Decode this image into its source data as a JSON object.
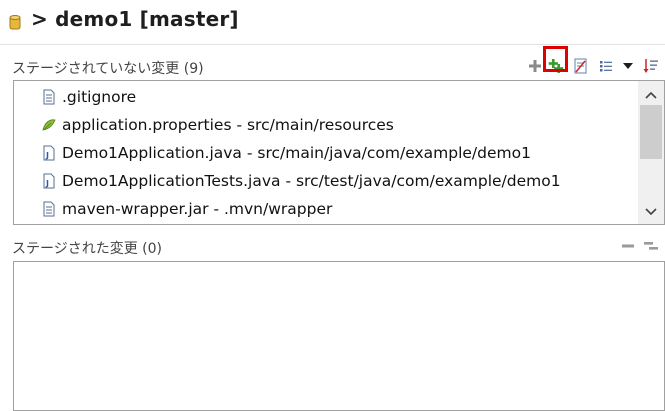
{
  "header": {
    "title": "> demo1 [master]"
  },
  "unstaged": {
    "title": "ステージされていない変更 (9)",
    "files": [
      {
        "name": ".gitignore",
        "icon": "text-file-icon"
      },
      {
        "name": "application.properties - src/main/resources",
        "icon": "properties-file-icon"
      },
      {
        "name": "Demo1Application.java - src/main/java/com/example/demo1",
        "icon": "java-file-icon"
      },
      {
        "name": "Demo1ApplicationTests.java - src/test/java/com/example/demo1",
        "icon": "java-file-icon"
      },
      {
        "name": "maven-wrapper.jar - .mvn/wrapper",
        "icon": "text-file-icon"
      }
    ],
    "toolbar": [
      "add-to-index-icon",
      "add-all-to-index-icon",
      "ignore-file-icon",
      "tree-presentation-icon",
      "view-menu-dropdown-icon",
      "sort-icon"
    ]
  },
  "staged": {
    "title": "ステージされた変更 (0)",
    "files": [],
    "toolbar": [
      "remove-from-index-icon",
      "remove-all-from-index-icon"
    ]
  },
  "colors": {
    "highlight": "#e00000",
    "add_green": "#3c9b2c"
  }
}
